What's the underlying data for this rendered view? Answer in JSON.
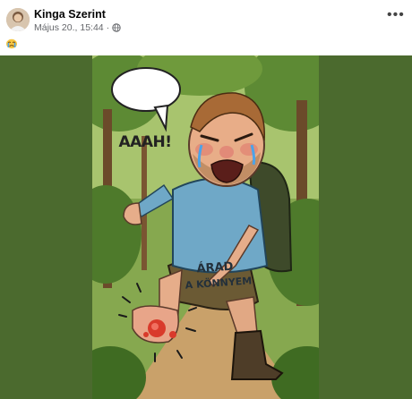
{
  "post": {
    "author_name": "Kinga Szerint",
    "timestamp": "Május 20., 15:44",
    "privacy_icon": "globe-icon",
    "more_icon": "more-options-icon",
    "body_emoji": "crying-face-emoji"
  },
  "image": {
    "speech_bubble_text": "AAAH!",
    "shirt_line_1": "ÁRAD",
    "shirt_line_2": "A KÖNNYEM"
  },
  "colors": {
    "page_background": "#ffffff",
    "media_background": "#4b6a2e",
    "author_text": "#050505",
    "meta_text": "#65676b"
  }
}
